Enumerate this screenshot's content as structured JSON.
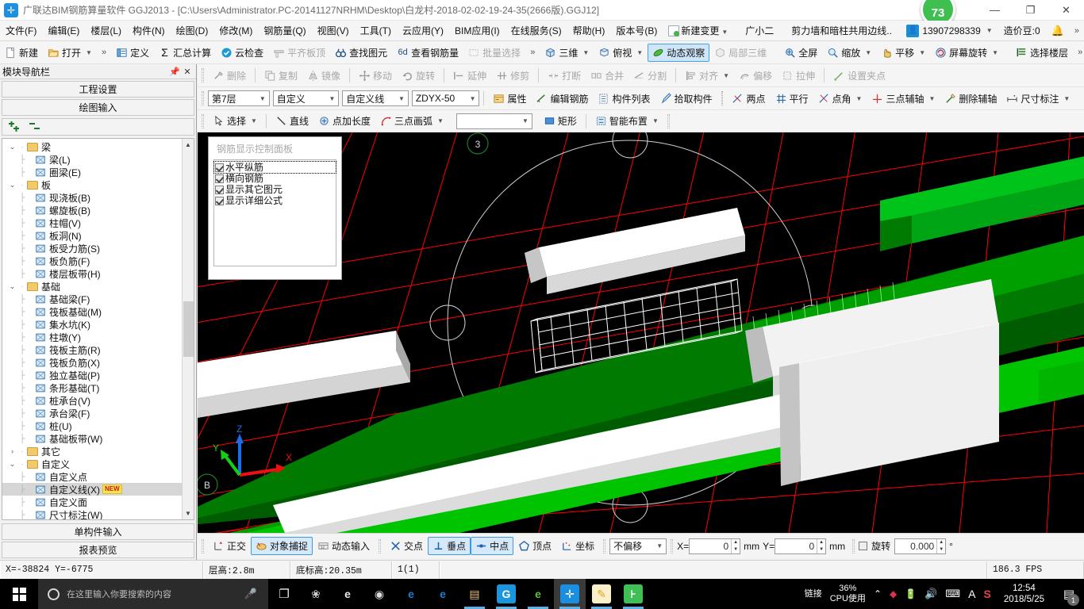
{
  "window": {
    "app_icon": "app-logo-icon",
    "title": "广联达BIM钢筋算量软件 GGJ2013 - [C:\\Users\\Administrator.PC-20141127NRHM\\Desktop\\白龙村-2018-02-02-19-24-35(2666版).GGJ12]",
    "minimize": "—",
    "maximize": "❐",
    "close": "✕",
    "score_badge": "73"
  },
  "menubar": {
    "items": [
      {
        "label": "文件(F)"
      },
      {
        "label": "编辑(E)"
      },
      {
        "label": "楼层(L)"
      },
      {
        "label": "构件(N)"
      },
      {
        "label": "绘图(D)"
      },
      {
        "label": "修改(M)"
      },
      {
        "label": "钢筋量(Q)"
      },
      {
        "label": "视图(V)"
      },
      {
        "label": "工具(T)"
      },
      {
        "label": "云应用(Y)"
      },
      {
        "label": "BIM应用(I)"
      },
      {
        "label": "在线服务(S)"
      },
      {
        "label": "帮助(H)"
      },
      {
        "label": "版本号(B)"
      }
    ],
    "new_change": "新建变更",
    "user_name": "广小二",
    "notice": "剪力墙和暗柱共用边线..",
    "phone": "13907298339",
    "coin": "造价豆:0",
    "bell_icon": "bell-icon",
    "overflow": "»"
  },
  "toolbar_main": {
    "new": "新建",
    "open": "打开",
    "overflow1": "»",
    "define": "定义",
    "summary": "汇总计算",
    "cloud_check": "云检查",
    "flush_slab_top": "平齐板顶",
    "find_element": "查找图元",
    "view_rebar": "查看钢筋量",
    "batch_select": "批量选择",
    "overflow2": "»",
    "three_d": "三维",
    "top_view": "俯视",
    "dynamic_observe": "动态观察",
    "local_3d": "局部三维",
    "fullscreen": "全屏",
    "zoom": "缩放",
    "pan": "平移",
    "screen_rotate": "屏幕旋转",
    "select_floor": "选择楼层",
    "overflow3": "»"
  },
  "toolbar_edit": {
    "delete": "删除",
    "copy": "复制",
    "mirror": "镜像",
    "move": "移动",
    "rotate": "旋转",
    "extend": "延伸",
    "trim": "修剪",
    "break": "打断",
    "merge": "合并",
    "split": "分割",
    "align": "对齐",
    "offset": "偏移",
    "stretch": "拉伸",
    "set_grip": "设置夹点"
  },
  "toolbar_props": {
    "floor": "第7层",
    "category": "自定义",
    "type": "自定义线",
    "member": "ZDYX-50",
    "properties": "属性",
    "edit_rebar": "编辑钢筋",
    "member_list": "构件列表",
    "pick_member": "拾取构件",
    "two_point": "两点",
    "parallel": "平行",
    "point_angle": "点角",
    "three_point_axis": "三点辅轴",
    "delete_axis": "删除辅轴",
    "dimension": "尺寸标注"
  },
  "toolbar_draw": {
    "select": "选择",
    "line": "直线",
    "point_length": "点加长度",
    "three_point_arc": "三点画弧",
    "combo_value": "",
    "rect": "矩形",
    "smart_layout": "智能布置"
  },
  "left_panel": {
    "header_title": "模块导航栏",
    "pin_icon": "pin-icon",
    "close_icon": "close-icon",
    "project_settings": "工程设置",
    "drawing_input": "绘图输入",
    "expand_all_icon": "expand-all-icon",
    "collapse_all_icon": "collapse-all-icon",
    "single_member_input": "单构件输入",
    "report_preview": "报表预览",
    "tree": [
      {
        "label": "梁",
        "type": "folder",
        "expanded": true,
        "level": 0
      },
      {
        "label": "梁(L)",
        "type": "leaf",
        "level": 1,
        "icon": "beam-icon"
      },
      {
        "label": "圈梁(E)",
        "type": "leaf",
        "level": 1,
        "icon": "ring-beam-icon"
      },
      {
        "label": "板",
        "type": "folder",
        "expanded": true,
        "level": 0
      },
      {
        "label": "现浇板(B)",
        "type": "leaf",
        "level": 1,
        "icon": "slab-icon"
      },
      {
        "label": "螺旋板(B)",
        "type": "leaf",
        "level": 1,
        "icon": "spiral-slab-icon"
      },
      {
        "label": "柱帽(V)",
        "type": "leaf",
        "level": 1,
        "icon": "column-cap-icon"
      },
      {
        "label": "板洞(N)",
        "type": "leaf",
        "level": 1,
        "icon": "slab-hole-icon"
      },
      {
        "label": "板受力筋(S)",
        "type": "leaf",
        "level": 1,
        "icon": "slab-main-rebar-icon"
      },
      {
        "label": "板负筋(F)",
        "type": "leaf",
        "level": 1,
        "icon": "slab-neg-rebar-icon"
      },
      {
        "label": "楼层板带(H)",
        "type": "leaf",
        "level": 1,
        "icon": "slab-band-icon"
      },
      {
        "label": "基础",
        "type": "folder",
        "expanded": true,
        "level": 0
      },
      {
        "label": "基础梁(F)",
        "type": "leaf",
        "level": 1,
        "icon": "foundation-beam-icon"
      },
      {
        "label": "筏板基础(M)",
        "type": "leaf",
        "level": 1,
        "icon": "raft-foundation-icon"
      },
      {
        "label": "集水坑(K)",
        "type": "leaf",
        "level": 1,
        "icon": "sump-pit-icon"
      },
      {
        "label": "柱墩(Y)",
        "type": "leaf",
        "level": 1,
        "icon": "column-pier-icon"
      },
      {
        "label": "筏板主筋(R)",
        "type": "leaf",
        "level": 1,
        "icon": "raft-main-rebar-icon"
      },
      {
        "label": "筏板负筋(X)",
        "type": "leaf",
        "level": 1,
        "icon": "raft-neg-rebar-icon"
      },
      {
        "label": "独立基础(P)",
        "type": "leaf",
        "level": 1,
        "icon": "isolated-footing-icon"
      },
      {
        "label": "条形基础(T)",
        "type": "leaf",
        "level": 1,
        "icon": "strip-footing-icon"
      },
      {
        "label": "桩承台(V)",
        "type": "leaf",
        "level": 1,
        "icon": "pile-cap-icon"
      },
      {
        "label": "承台梁(F)",
        "type": "leaf",
        "level": 1,
        "icon": "cap-beam-icon"
      },
      {
        "label": "桩(U)",
        "type": "leaf",
        "level": 1,
        "icon": "pile-icon"
      },
      {
        "label": "基础板带(W)",
        "type": "leaf",
        "level": 1,
        "icon": "foundation-band-icon"
      },
      {
        "label": "其它",
        "type": "folder",
        "expanded": false,
        "level": 0
      },
      {
        "label": "自定义",
        "type": "folder",
        "expanded": true,
        "level": 0
      },
      {
        "label": "自定义点",
        "type": "leaf",
        "level": 1,
        "icon": "custom-point-icon"
      },
      {
        "label": "自定义线(X)",
        "type": "leaf",
        "level": 1,
        "icon": "custom-line-icon",
        "selected": true,
        "badge": "NEW"
      },
      {
        "label": "自定义面",
        "type": "leaf",
        "level": 1,
        "icon": "custom-face-icon"
      },
      {
        "label": "尺寸标注(W)",
        "type": "leaf",
        "level": 1,
        "icon": "dimension-icon"
      }
    ]
  },
  "rebar_panel": {
    "title": "钢筋显示控制面板",
    "options": [
      {
        "label": "水平纵筋",
        "checked": true,
        "focused": true
      },
      {
        "label": "横向钢筋",
        "checked": true,
        "focused": false
      },
      {
        "label": "显示其它图元",
        "checked": true,
        "focused": false
      },
      {
        "label": "显示详细公式",
        "checked": true,
        "focused": false
      }
    ]
  },
  "viewport": {
    "axis_labels": {
      "x": "X",
      "y": "Y",
      "z": "Z"
    },
    "grid_bubbles": [
      "3",
      "B"
    ],
    "background": "#000000",
    "grid_color": "#ff0000",
    "element_green": "#009900",
    "element_bright_green": "#00dd00",
    "element_grey": "#e0e0e0"
  },
  "snapbar": {
    "ortho": "正交",
    "object_snap": "对象捕捉",
    "dynamic_input": "动态输入",
    "intersection": "交点",
    "perpendicular": "垂点",
    "midpoint": "中点",
    "vertex": "顶点",
    "coordinate": "坐标",
    "offset_mode": "不偏移",
    "x_label": "X=",
    "x_value": "0",
    "x_unit": "mm",
    "y_label": "Y=",
    "y_value": "0",
    "y_unit": "mm",
    "rotate_label": "旋转",
    "rotate_value": "0.000",
    "rotate_unit": "°"
  },
  "statusbar": {
    "coords": "X=-38824  Y=-6775",
    "floor_height": "层高:2.8m",
    "base_elevation": "底标高:20.35m",
    "scale": "1(1)",
    "blank": "",
    "fps": "186.3 FPS"
  },
  "taskbar": {
    "start_icon": "windows-start-icon",
    "search_placeholder": "在这里输入你要搜索的内容",
    "cortana_icon": "cortana-circle-icon",
    "mic_icon": "microphone-icon",
    "task_view_icon": "task-view-icon",
    "apps": [
      {
        "name": "sogou-pinwheel-icon",
        "glyph": "❀",
        "color": "#cfcfcf",
        "bg": "transparent",
        "running": false
      },
      {
        "name": "edge-legacy-icon",
        "glyph": "e",
        "color": "#e9e9e9",
        "bg": "transparent",
        "running": false
      },
      {
        "name": "spiral-notify-icon",
        "glyph": "◉",
        "color": "#dcdcdc",
        "bg": "transparent",
        "running": false
      },
      {
        "name": "edge-icon",
        "glyph": "e",
        "color": "#1a7fd4",
        "bg": "transparent",
        "running": false
      },
      {
        "name": "internet-explorer-icon",
        "glyph": "e",
        "color": "#1a7fd4",
        "bg": "transparent",
        "running": false
      },
      {
        "name": "file-explorer-icon",
        "glyph": "▤",
        "color": "#f0c070",
        "bg": "transparent",
        "running": true
      },
      {
        "name": "glodon-cloud-icon",
        "glyph": "G",
        "color": "#ffffff",
        "bg": "#1a96dc",
        "running": true
      },
      {
        "name": "green-browser-icon",
        "glyph": "e",
        "color": "#5bbf3c",
        "bg": "transparent",
        "running": true
      },
      {
        "name": "ggj-app-icon",
        "glyph": "✛",
        "color": "#ffffff",
        "bg": "#1a8fe0",
        "running": true,
        "focused": true
      },
      {
        "name": "notepad-app-icon",
        "glyph": "✎",
        "color": "#d9a52a",
        "bg": "#fbf0c8",
        "running": true
      },
      {
        "name": "green-tools-icon",
        "glyph": "⊦",
        "color": "#ffffff",
        "bg": "#3fbf55",
        "running": true
      }
    ],
    "link_label": "链接",
    "cpu_percent": "36%",
    "cpu_label": "CPU使用",
    "tray_icons": [
      {
        "name": "show-hidden-icons-chevron",
        "glyph": "⌃"
      },
      {
        "name": "ruby-icon",
        "glyph": "◆",
        "color": "#d9344a"
      },
      {
        "name": "battery-icon",
        "glyph": "🔋"
      },
      {
        "name": "volume-icon",
        "glyph": "🔊"
      },
      {
        "name": "keyboard-icon",
        "glyph": "⌨"
      },
      {
        "name": "ime-a-icon",
        "glyph": "A"
      },
      {
        "name": "sogou-ime-icon",
        "glyph": "S",
        "color": "#e64545"
      }
    ],
    "time": "12:54",
    "date": "2018/5/25",
    "notification_count": "1",
    "notification_icon": "action-center-icon"
  }
}
